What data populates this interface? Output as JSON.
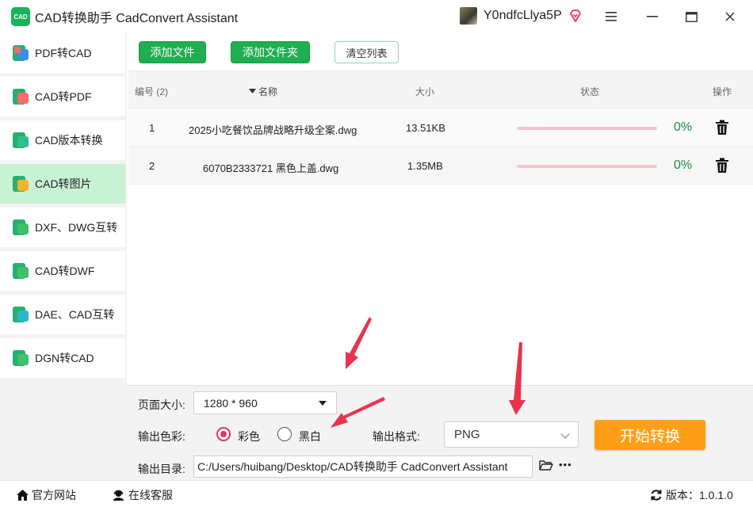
{
  "app": {
    "logo_text": "CAD",
    "title": "CAD转换助手 CadConvert Assistant",
    "username": "Y0ndfcLlya5P"
  },
  "sidebar": {
    "items": [
      {
        "label": "PDF转CAD",
        "active": false
      },
      {
        "label": "CAD转PDF",
        "active": false
      },
      {
        "label": "CAD版本转换",
        "active": false
      },
      {
        "label": "CAD转图片",
        "active": true
      },
      {
        "label": "DXF、DWG互转",
        "active": false
      },
      {
        "label": "CAD转DWF",
        "active": false
      },
      {
        "label": "DAE、CAD互转",
        "active": false
      },
      {
        "label": "DGN转CAD",
        "active": false
      }
    ]
  },
  "toolbar": {
    "add_file": "添加文件",
    "add_folder": "添加文件夹",
    "clear_list": "清空列表"
  },
  "table": {
    "headers": {
      "index": "编号 (2)",
      "name": "名称",
      "size": "大小",
      "status": "状态",
      "action": "操作"
    },
    "rows": [
      {
        "index": "1",
        "name": "2025小吃餐饮品牌战略升级全案.dwg",
        "size": "13.51KB",
        "progress": "0%"
      },
      {
        "index": "2",
        "name": "6070B2333721 黑色上盖.dwg",
        "size": "1.35MB",
        "progress": "0%"
      }
    ]
  },
  "settings": {
    "page_size_label": "页面大小:",
    "page_size_value": "1280 * 960",
    "color_label": "输出色彩:",
    "color_option_1": "彩色",
    "color_option_2": "黑白",
    "color_selected": "彩色",
    "format_label": "输出格式:",
    "format_value": "PNG",
    "start_button": "开始转换",
    "output_dir_label": "输出目录:",
    "output_dir_value": "C:/Users/huibang/Desktop/CAD转换助手 CadConvert Assistant",
    "more": "•••"
  },
  "statusbar": {
    "website": "官方网站",
    "support": "在线客服",
    "version_label": "版本：",
    "version": "1.0.1.0"
  },
  "colors": {
    "accent_green": "#1fae50",
    "active_item": "#c8f2d4",
    "start_orange": "#ff9f17",
    "radio_selected": "#e0345c",
    "progress_track": "#f2c4cf",
    "percent_text": "#1c8c3a",
    "annotation_arrow": "#e8344e"
  }
}
